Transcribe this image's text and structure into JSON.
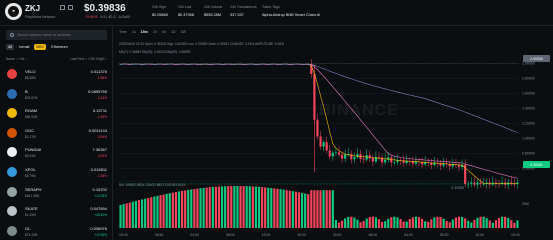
{
  "header": {
    "symbol": "ZKJ",
    "name": "Polyhedra Network",
    "price": "$0.39836",
    "change": "-79.90%",
    "change_extra": "8.8 | $0.3...1c2a55",
    "stats": [
      {
        "label": "24h High",
        "value": "$2.0586K"
      },
      {
        "label": "24h Low",
        "value": "$0.37958"
      },
      {
        "label": "24h Volume",
        "value": "$555.28M"
      },
      {
        "label": "24h Transactions",
        "value": "337,337"
      },
      {
        "label": "Token Tags",
        "value": "Alpha Airdrop  BNB Smart Chain  AI"
      }
    ]
  },
  "search": {
    "placeholder": "Search tokens name or address"
  },
  "filters": [
    "All",
    "Iomail",
    "BSC",
    "Ethereum"
  ],
  "list_header": {
    "left": "Name ↕ / Vol ↕",
    "right": "Last Price ↕ / 24h Chg% ↕"
  },
  "tokens": [
    {
      "name": "VELO",
      "sub": "$6.38M",
      "price": "0.011376",
      "change": "-1.68%",
      "color": "#e84142",
      "trend": "neg"
    },
    {
      "name": "B",
      "sub": "$28.87M",
      "price": "0.0895755",
      "change": "-2.43%",
      "color": "#2b6cb0",
      "trend": "neg"
    },
    {
      "name": "ROAM",
      "sub": "$86.92M",
      "price": "0.15711",
      "change": "-1.49%",
      "color": "#f0b90b",
      "trend": "neg"
    },
    {
      "name": "GGC",
      "sub": "$1.27M",
      "price": "0.0011133",
      "change": "-0.54%",
      "color": "#d35400",
      "trend": "neg"
    },
    {
      "name": "PUNDIAI",
      "sub": "$6.09M",
      "price": "7.36367",
      "change": "-4.03%",
      "color": "#ecf0f1",
      "trend": "neg"
    },
    {
      "name": "XPOL",
      "sub": "$6.79M",
      "price": "0.015811",
      "change": "-1.35%",
      "color": "#3498db",
      "trend": "neg"
    },
    {
      "name": "SERAPH",
      "sub": "$641.39M",
      "price": "0.19702",
      "change": "+14.28%",
      "color": "#95a5a6",
      "trend": "pos"
    },
    {
      "name": "SKATE",
      "sub": "$1.39M",
      "price": "0.047694",
      "change": "+46.40%",
      "color": "#bdc3c7",
      "trend": "pos"
    },
    {
      "name": "OL",
      "sub": "$73.43M",
      "price": "0.036976",
      "change": "+10.96%",
      "color": "#7f8c8d",
      "trend": "pos"
    }
  ],
  "chart": {
    "timeframes": [
      "Time",
      "1s",
      "15m",
      "1h",
      "4h",
      "1D",
      "1W"
    ],
    "active_tf": "15m",
    "ohlc": "2025/06/16 16:30  Open: 0.38126  High: 0.40083  Low: 0.37689  Close: 0.39391  CHANGE: 3.03%  AMPLITUDE: 6.35%",
    "ma_line": "MA(7): 0.36669  MA(25): 0.42034  MA(99): 0.96599",
    "volume_line": "Vol: 156481.06SA  134432.6823  1282451.8314",
    "y_labels": [
      "2.00000",
      "1.80000",
      "1.60000",
      "1.40000",
      "1.20000",
      "1.00000",
      "0.80000",
      "0.60000"
    ],
    "x_labels": [
      "16:00",
      "06/15",
      "04:00",
      "08:00",
      "12:00",
      "16:00",
      "20:00",
      "06/16",
      "04:00",
      "08:00",
      "12:00",
      "16:00"
    ],
    "current_price": "0.39391",
    "top_price": "2.00000",
    "low_marker": "0.33958",
    "vol_axis": "20M",
    "watermark": "BINANCE",
    "colors": {
      "up": "#0ecb81",
      "down": "#f6465d",
      "ma7": "#f0b90b",
      "ma25": "#e377c2",
      "ma99": "#8e7cc3"
    }
  }
}
